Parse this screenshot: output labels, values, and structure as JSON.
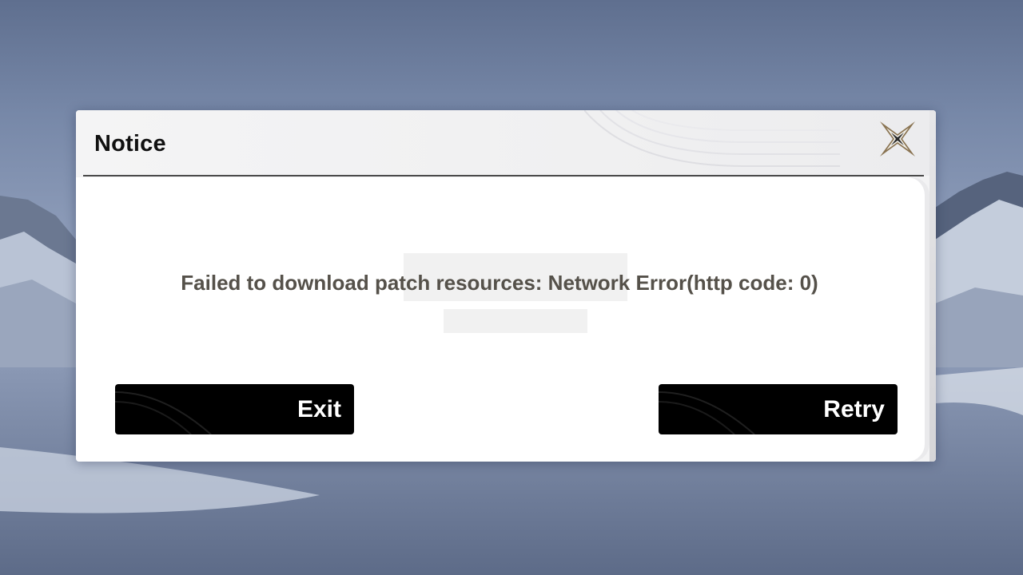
{
  "dialog": {
    "title": "Notice",
    "message": "Failed to download patch resources: Network Error(http code: 0)",
    "exit_label": "Exit",
    "retry_label": "Retry"
  },
  "colors": {
    "button_bg": "#000000",
    "button_text": "#ffffff",
    "message_text": "#55514a",
    "close_icon": "#8a7452"
  },
  "icons": {
    "close": "close-x-icon"
  }
}
